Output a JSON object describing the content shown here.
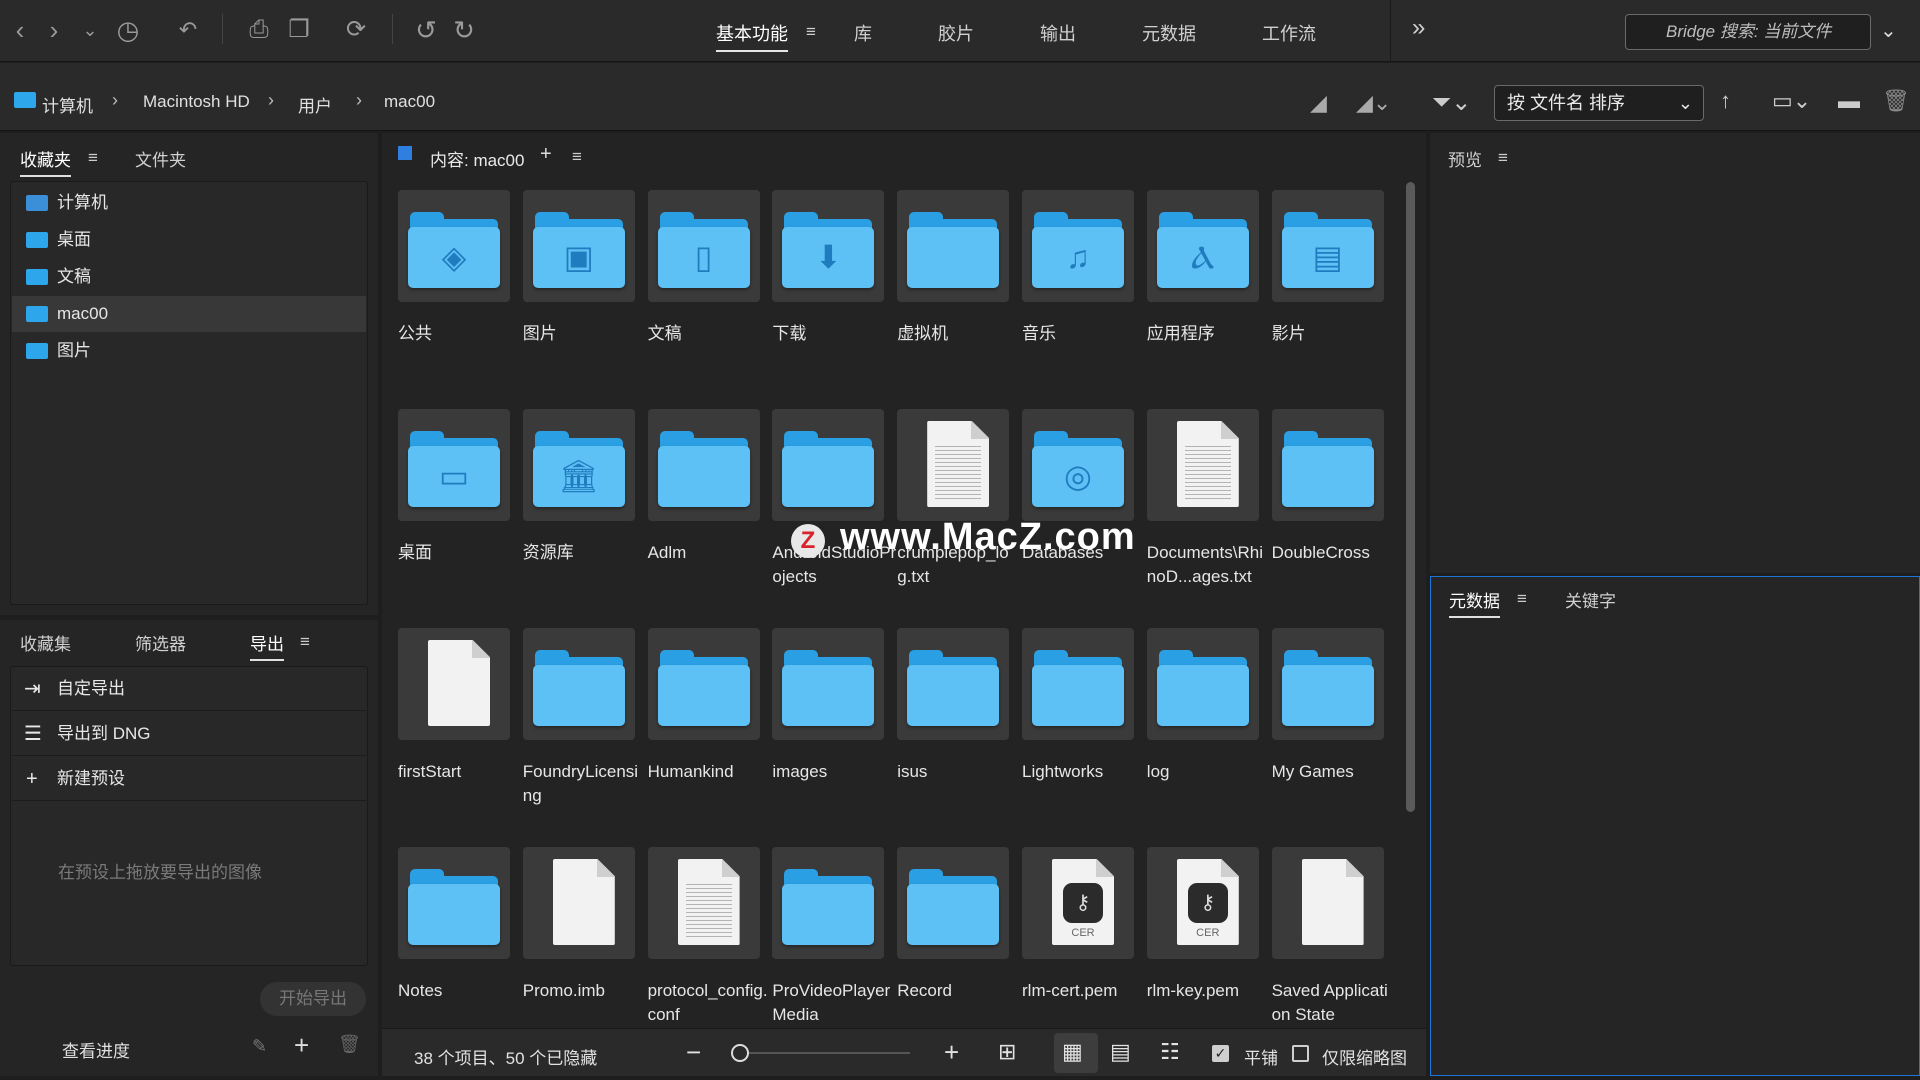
{
  "toolbar": {
    "workspaces": [
      "基本功能",
      "库",
      "胶片",
      "输出",
      "元数据",
      "工作流"
    ],
    "active_workspace": "基本功能",
    "more": "»",
    "search_placeholder": "Bridge 搜索: 当前文件"
  },
  "path": {
    "crumbs": [
      "计算机",
      "Macintosh HD",
      "用户",
      "mac00"
    ],
    "sort_label": "按 文件名 排序"
  },
  "left_top": {
    "tabs": [
      "收藏夹",
      "文件夹"
    ],
    "favorites": [
      "计算机",
      "桌面",
      "文稿",
      "mac00",
      "图片"
    ],
    "selected_favorite": "mac00"
  },
  "left_bottom": {
    "tabs": [
      "收藏集",
      "筛选器",
      "导出"
    ],
    "export_items": [
      "自定导出",
      "导出到 DNG",
      "新建预设"
    ],
    "drop_hint": "在预设上拖放要导出的图像",
    "start_button": "开始导出",
    "progress_label": "查看进度"
  },
  "content": {
    "title": "内容: mac00",
    "items": [
      {
        "label": "公共",
        "kind": "folder",
        "glyph": "◈"
      },
      {
        "label": "图片",
        "kind": "folder",
        "glyph": "▣"
      },
      {
        "label": "文稿",
        "kind": "folder",
        "glyph": "▯"
      },
      {
        "label": "下载",
        "kind": "folder",
        "glyph": "⬇"
      },
      {
        "label": "虚拟机",
        "kind": "folder",
        "glyph": ""
      },
      {
        "label": "音乐",
        "kind": "folder",
        "glyph": "♫"
      },
      {
        "label": "应用程序",
        "kind": "folder",
        "glyph": "Ⲁ"
      },
      {
        "label": "影片",
        "kind": "folder",
        "glyph": "▤"
      },
      {
        "label": "桌面",
        "kind": "folder",
        "glyph": "▭"
      },
      {
        "label": "资源库",
        "kind": "folder",
        "glyph": "🏛"
      },
      {
        "label": "Adlm",
        "kind": "folder",
        "glyph": ""
      },
      {
        "label": "AndroidStudioProjects",
        "kind": "folder",
        "glyph": ""
      },
      {
        "label": "crumplepop_log.txt",
        "kind": "text",
        "glyph": ""
      },
      {
        "label": "Databases",
        "kind": "folder",
        "glyph": "◎"
      },
      {
        "label": "Documents\\RhinoD...ages.txt",
        "kind": "text",
        "glyph": ""
      },
      {
        "label": "DoubleCross",
        "kind": "folder",
        "glyph": ""
      },
      {
        "label": "firstStart",
        "kind": "blank",
        "glyph": ""
      },
      {
        "label": "FoundryLicensing",
        "kind": "folder",
        "glyph": ""
      },
      {
        "label": "Humankind",
        "kind": "folder",
        "glyph": ""
      },
      {
        "label": "images",
        "kind": "folder",
        "glyph": ""
      },
      {
        "label": "isus",
        "kind": "folder",
        "glyph": ""
      },
      {
        "label": "Lightworks",
        "kind": "folder",
        "glyph": ""
      },
      {
        "label": "log",
        "kind": "folder",
        "glyph": ""
      },
      {
        "label": "My Games",
        "kind": "folder",
        "glyph": ""
      },
      {
        "label": "Notes",
        "kind": "folder",
        "glyph": ""
      },
      {
        "label": "Promo.imb",
        "kind": "blank",
        "glyph": ""
      },
      {
        "label": "protocol_config.conf",
        "kind": "text",
        "glyph": ""
      },
      {
        "label": "ProVideoPlayer Media",
        "kind": "folder",
        "glyph": ""
      },
      {
        "label": "Record",
        "kind": "folder",
        "glyph": ""
      },
      {
        "label": "rlm-cert.pem",
        "kind": "cert",
        "glyph": "⚷"
      },
      {
        "label": "rlm-key.pem",
        "kind": "cert",
        "glyph": "⚷"
      },
      {
        "label": "Saved Application State",
        "kind": "blank",
        "glyph": ""
      }
    ],
    "cert_label": "CER"
  },
  "status": {
    "count": "38 个项目、50 个已隐藏",
    "tile_label": "平铺",
    "thumbs_only_label": "仅限缩略图",
    "tile_checked": true,
    "thumbs_only_checked": false,
    "zoom_level": 0.0
  },
  "right": {
    "preview_tab": "预览",
    "meta_tabs": [
      "元数据",
      "关键字"
    ]
  },
  "watermark": {
    "text": "www.MacZ.com",
    "logo": "Z"
  },
  "colors": {
    "accent": "#2ea6ec",
    "folder_front": "#5ec1f5",
    "folder_back": "#2a9fe3",
    "selection": "#1f75d8"
  }
}
